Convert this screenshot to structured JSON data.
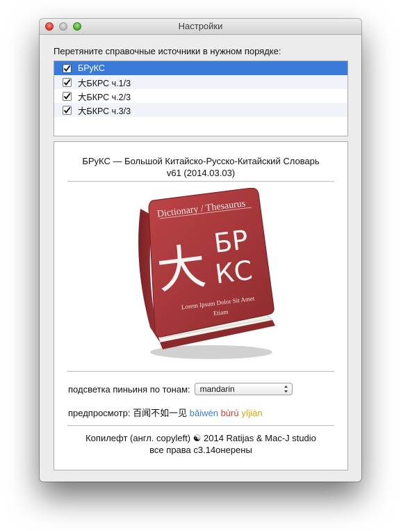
{
  "window": {
    "title": "Настройки"
  },
  "sources": {
    "instruction": "Перетяните справочные источники в нужном порядке:",
    "items": [
      {
        "label": "БРуКС",
        "checked": true,
        "selected": true
      },
      {
        "label": "大БКРС ч.1/3",
        "checked": true,
        "selected": false
      },
      {
        "label": "大БКРС ч.2/3",
        "checked": true,
        "selected": false
      },
      {
        "label": "大БКРС ч.3/3",
        "checked": true,
        "selected": false
      }
    ]
  },
  "about": {
    "title_line1": "БРуКС — Большой Китайско-Русско-Китайский Словарь",
    "title_line2": "v61 (2014.03.03)"
  },
  "book": {
    "header": "Dictionary / Thesaurus",
    "big_char": "大",
    "letters_top": "БР",
    "letters_bottom": "КС",
    "subtitle1": "Lorem Ipsum Dolor Sit Amet",
    "subtitle2": "Etiam",
    "cover_color": "#a9393c"
  },
  "tone_highlight": {
    "label": "подсветка пиньиня по тонам:",
    "selected_value": "mandarin"
  },
  "preview": {
    "label": "предпросмотр:",
    "hanzi": "百闻不如一见",
    "pinyin": [
      {
        "text": "bǎiwén",
        "tone": "tone1",
        "color": "#3c7bd4"
      },
      {
        "text": "bùrú",
        "tone": "tone4",
        "color": "#d43d2a"
      },
      {
        "text": "yījiàn",
        "tone": "tone3",
        "color": "#d4a400"
      }
    ]
  },
  "copyright": {
    "line1": "Копилефт (англ. copyleft) ☯ 2014 Ratijas & Mac-J studio",
    "line2": "все права с3.14онерены"
  }
}
